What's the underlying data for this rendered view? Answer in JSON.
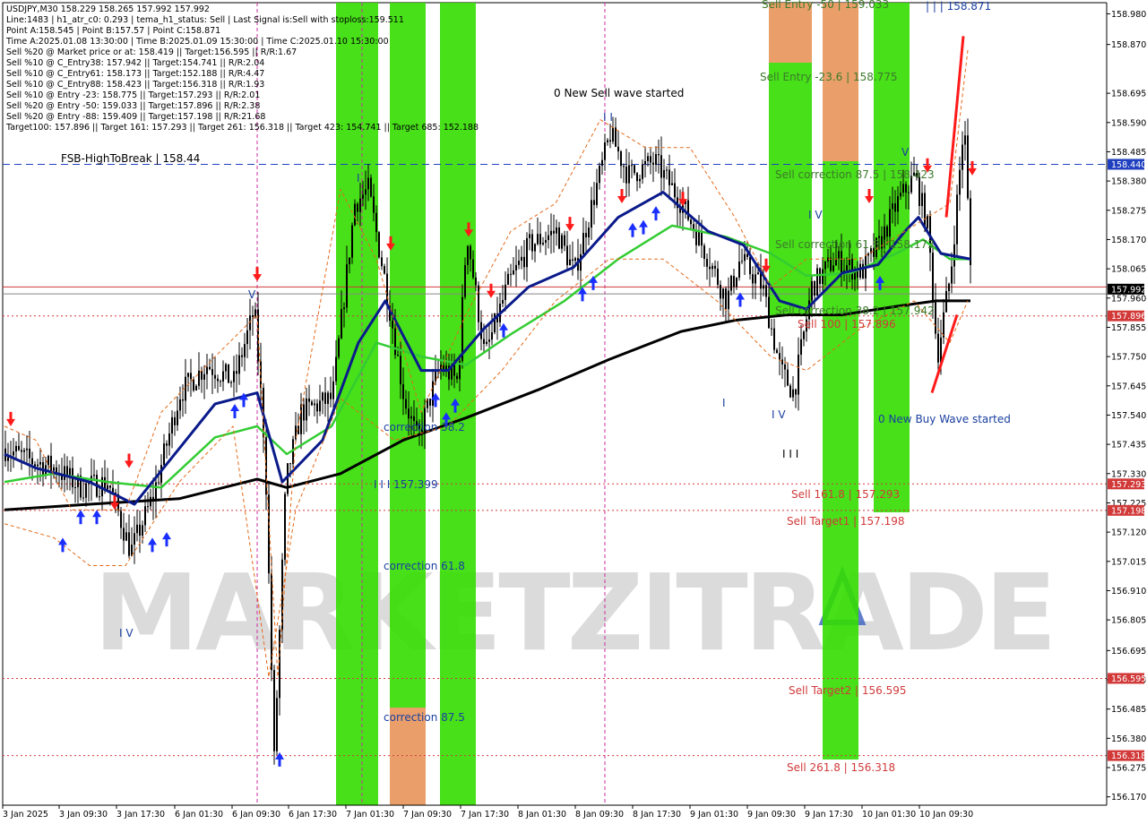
{
  "chart_data": {
    "type": "candlestick",
    "symbol": "USDJPY,M30",
    "info_lines": [
      "USDJPY,M30  158.229 158.265 157.992 157.992",
      "Line:1483  |  h1_atr_c0: 0.293  |  tema_h1_status: Sell  |  Last Signal is:Sell with stoploss:159.511",
      "Point A:158.545  |  Point B:157.57  |  Point C:158.871",
      "Time A:2025.01.08 13:30:00  |  Time B:2025.01.09 15:30:00  |  Time C:2025.01.10 15:30:00",
      "Sell %20 @ Market price or at: 158.419  ||  Target:156.595  ||  R/R:1.67",
      "Sell %10 @ C_Entry38: 157.942  ||  Target:154.741  ||  R/R:2.04",
      "Sell %10 @ C_Entry61: 158.173  ||  Target:152.188  ||  R/R:4.47",
      "Sell %10 @ C_Entry88: 158.423  ||  Target:156.318  ||  R/R:1.93",
      "Sell %10 @ Entry -23: 158.775  ||  Target:157.293  ||  R/R:2.01",
      "Sell %20 @ Entry -50: 159.033  ||  Target:157.896  ||  R/R:2.38",
      "Sell %20 @ Entry -88: 159.409  ||  Target:157.198  ||  R/R:21.68",
      "Target100: 157.896  ||  Target 161: 157.293  ||  Target 261: 156.318  ||  Target 423: 154.741  ||  Target 685: 152.188"
    ],
    "y_ticks": [
      "158.980",
      "158.870",
      "158.695",
      "158.590",
      "158.485",
      "158.380",
      "158.275",
      "158.170",
      "158.065",
      "157.960",
      "157.855",
      "157.750",
      "157.645",
      "157.540",
      "157.435",
      "157.330",
      "157.225",
      "157.120",
      "157.015",
      "156.910",
      "156.805",
      "156.695",
      "156.590",
      "156.485",
      "156.380",
      "156.275",
      "156.170"
    ],
    "x_ticks": [
      "3 Jan 2025",
      "3 Jan 09:30",
      "3 Jan 17:30",
      "6 Jan 01:30",
      "6 Jan 09:30",
      "6 Jan 17:30",
      "7 Jan 01:30",
      "7 Jan 09:30",
      "7 Jan 17:30",
      "8 Jan 01:30",
      "8 Jan 09:30",
      "8 Jan 17:30",
      "9 Jan 01:30",
      "9 Jan 09:30",
      "9 Jan 17:30",
      "10 Jan 01:30",
      "10 Jan 09:30"
    ],
    "ylim": [
      156.14,
      159.02
    ],
    "current_price": "157.992",
    "price_tags": [
      {
        "label": "158.440",
        "value": 158.44,
        "color": "#1f3fbf"
      },
      {
        "label": "157.992",
        "value": 157.992,
        "color": "#000000"
      },
      {
        "label": "157.896",
        "value": 157.896,
        "color": "#d23a3a"
      },
      {
        "label": "157.293",
        "value": 157.293,
        "color": "#d23a3a"
      },
      {
        "label": "157.198",
        "value": 157.198,
        "color": "#d23a3a"
      },
      {
        "label": "156.595",
        "value": 156.595,
        "color": "#d23a3a"
      },
      {
        "label": "156.318",
        "value": 156.318,
        "color": "#d23a3a"
      }
    ],
    "annotations": [
      {
        "text": "Sell Entry -50 | 159.033",
        "color": "#3c7a2a"
      },
      {
        "text": "| | | 158.871",
        "color": "#1a3fa0"
      },
      {
        "text": "Sell Entry -23.6 | 158.775",
        "color": "#3c7a2a"
      },
      {
        "text": "0 New Sell wave started",
        "color": "#000000"
      },
      {
        "text": "I I",
        "color": "#1a3fa0"
      },
      {
        "text": "FSB-HighToBreak | 158.44",
        "color": "#000000"
      },
      {
        "text": "Sell correction 87.5 | 158.423",
        "color": "#3c7a2a"
      },
      {
        "text": "V",
        "color": "#1a3fa0"
      },
      {
        "text": "I V",
        "color": "#1a3fa0"
      },
      {
        "text": "Sell correction 61.8 | 158.173",
        "color": "#3c7a2a"
      },
      {
        "text": "Sell correction 38.2 | 157.942",
        "color": "#3c7a2a"
      },
      {
        "text": "Sell 100 | 157.896",
        "color": "#d23a3a"
      },
      {
        "text": "I",
        "color": "#1a3fa0"
      },
      {
        "text": "I V",
        "color": "#1a3fa0"
      },
      {
        "text": "0 New Buy Wave started",
        "color": "#1a3fa0"
      },
      {
        "text": "correction 38.2",
        "color": "#1a3fa0"
      },
      {
        "text": "I I I",
        "color": "#000000"
      },
      {
        "text": "I I I 157.399",
        "color": "#1a3fa0"
      },
      {
        "text": "Sell 161.8 | 157.293",
        "color": "#d23a3a"
      },
      {
        "text": "Sell Target1 | 157.198",
        "color": "#d23a3a"
      },
      {
        "text": "V",
        "color": "#1a3fa0"
      },
      {
        "text": "correction 61.8",
        "color": "#1a3fa0"
      },
      {
        "text": "I V",
        "color": "#1a3fa0"
      },
      {
        "text": "Sell Target2 | 156.595",
        "color": "#d23a3a"
      },
      {
        "text": "correction 87.5",
        "color": "#1a3fa0"
      },
      {
        "text": "Sell 261.8 | 156.318",
        "color": "#d23a3a"
      },
      {
        "text": "I",
        "color": "#1a3fa0"
      }
    ],
    "watermark": "MARKETZITRADE",
    "colors": {
      "green_zone": "#33dd00",
      "orange_zone": "#e8955a",
      "ma_blue": "#0a1a8a",
      "ma_green": "#33cc33",
      "ma_black": "#000000",
      "level_red": "#d23a3a",
      "level_blue": "#1f3fbf"
    }
  }
}
